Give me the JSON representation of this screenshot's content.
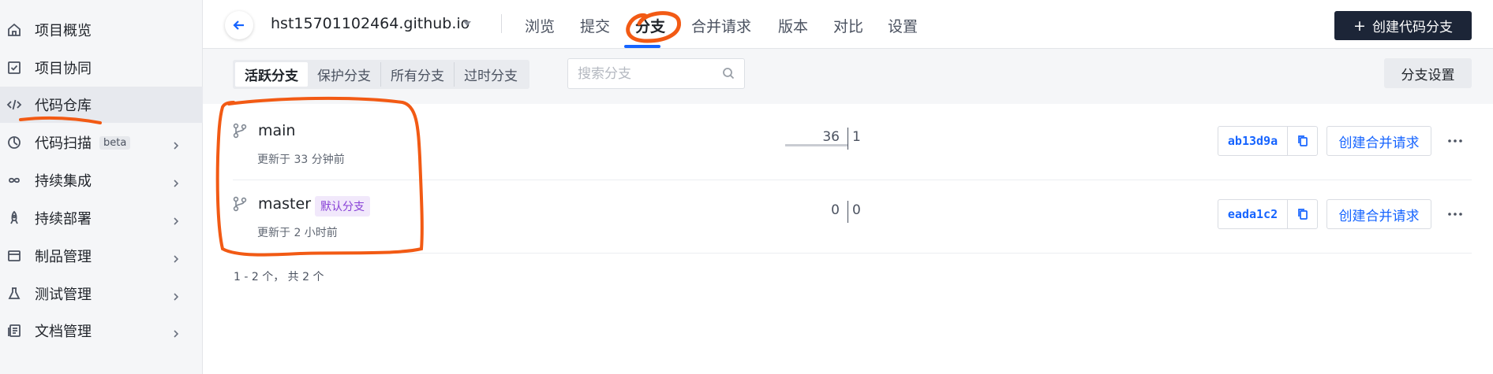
{
  "sidebar": {
    "items": [
      {
        "label": "项目概览",
        "icon": "home-icon"
      },
      {
        "label": "项目协同",
        "icon": "checkbox-icon"
      },
      {
        "label": "代码仓库",
        "icon": "code-icon"
      },
      {
        "label": "代码扫描",
        "icon": "scan-icon",
        "badge": "beta"
      },
      {
        "label": "持续集成",
        "icon": "infinity-icon"
      },
      {
        "label": "持续部署",
        "icon": "rocket-icon"
      },
      {
        "label": "制品管理",
        "icon": "package-icon"
      },
      {
        "label": "测试管理",
        "icon": "flask-icon"
      },
      {
        "label": "文档管理",
        "icon": "document-icon"
      }
    ]
  },
  "header": {
    "repo_name": "hst15701102464.github.io",
    "tabs": [
      "浏览",
      "提交",
      "分支",
      "合并请求",
      "版本",
      "对比",
      "设置"
    ],
    "active_tab": "分支",
    "create_button": "创建代码分支"
  },
  "filter": {
    "segments": [
      "活跃分支",
      "保护分支",
      "所有分支",
      "过时分支"
    ],
    "active_segment": "活跃分支",
    "search_placeholder": "搜索分支",
    "settings_button": "分支设置"
  },
  "branches": [
    {
      "name": "main",
      "updated": "更新于 33 分钟前",
      "behind": "36",
      "ahead": "1",
      "behind_value": 36,
      "ahead_value": 1,
      "commit": "ab13d9a",
      "mr_button": "创建合并请求",
      "default_tag": ""
    },
    {
      "name": "master",
      "updated": "更新于 2 小时前",
      "behind": "0",
      "ahead": "0",
      "behind_value": 0,
      "ahead_value": 0,
      "commit": "eada1c2",
      "mr_button": "创建合并请求",
      "default_tag": "默认分支"
    }
  ],
  "pagination": "1 - 2 个， 共 2 个",
  "colors": {
    "accent": "#1664ff",
    "dark_button": "#1c2537",
    "annotation": "#f25a14",
    "default_tag_bg": "#f1e8fb",
    "default_tag_fg": "#8740d6"
  }
}
